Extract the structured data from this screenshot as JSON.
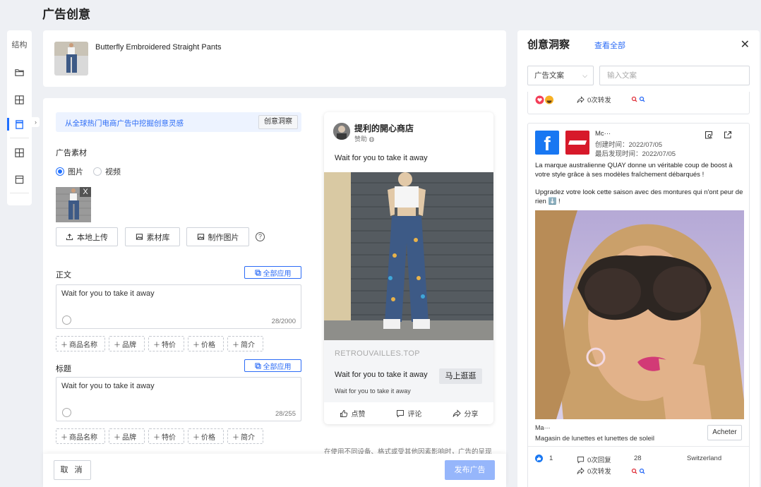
{
  "page": {
    "title": "广告创意"
  },
  "rail": {
    "title": "结构",
    "items": [
      {
        "icon": "folder-icon",
        "active": false
      },
      {
        "icon": "grid-icon",
        "active": false
      },
      {
        "icon": "ad-card-icon",
        "active": true
      },
      {
        "icon": "grid-icon",
        "active": false
      },
      {
        "icon": "calendar-icon",
        "active": false
      }
    ]
  },
  "product": {
    "name": "Butterfly Embroidered Straight Pants"
  },
  "editor": {
    "inspiration_text": "从全球热门电商广告中挖掘创意灵感",
    "inspiration_button": "创意洞察",
    "material_label": "广告素材",
    "media_types": [
      {
        "label": "图片",
        "selected": true
      },
      {
        "label": "视频",
        "selected": false
      }
    ],
    "material_remove": "X",
    "upload_buttons": [
      "本地上传",
      "素材库",
      "制作图片"
    ],
    "help": "?",
    "body_label": "正文",
    "apply_all": "全部应用",
    "body_text": "Wait for you to take it away",
    "body_count": "28/2000",
    "tags": [
      "商品名称",
      "品牌",
      "特价",
      "价格",
      "简介"
    ],
    "headline_label": "标题",
    "headline_text": "Wait for you to take it away",
    "headline_count": "28/255"
  },
  "preview": {
    "shop": "提利的開心商店",
    "sponsored": "赞助",
    "body": "Wait for you to take it away",
    "domain": "RETROUVAILLES.TOP",
    "headline": "Wait for you to take it away",
    "description": "Wait for you to take it away",
    "cta": "马上逛逛",
    "actions": [
      "点赞",
      "评论",
      "分享"
    ],
    "note": "在使用不同设备、格式或受其他因素影响时，广告的呈现"
  },
  "footer": {
    "cancel": "取 消",
    "publish": "发布广告"
  },
  "insights": {
    "title": "创意洞察",
    "view_all": "查看全部",
    "close": "✕",
    "filter_select": "广告文案",
    "search_placeholder": "输入文案",
    "card_a": {
      "shares": "0次转发"
    },
    "card_b": {
      "advertiser": "Mc···",
      "created": "创建时间：2022/07/05",
      "last_seen": "最后发现时间：2022/07/05",
      "text_1": "La marque australienne QUAY donne un véritable coup de boost à votre style grâce à ses modèles fraîchement débarqués !",
      "text_2": "Upgradez votre look cette saison avec des montures qui n'ont peur de rien ⬇️ !",
      "store_masked": "Ma···",
      "store": "Magasin de lunettes et lunettes de soleil",
      "buy": "Acheter",
      "likes": "1",
      "replies": "0次回复",
      "shares": "0次转发",
      "count": "28",
      "country": "Switzerland"
    }
  },
  "colors": {
    "accent": "#2c6cf6",
    "publish_disabled": "#96b6fb",
    "facebook": "#1877f2"
  }
}
